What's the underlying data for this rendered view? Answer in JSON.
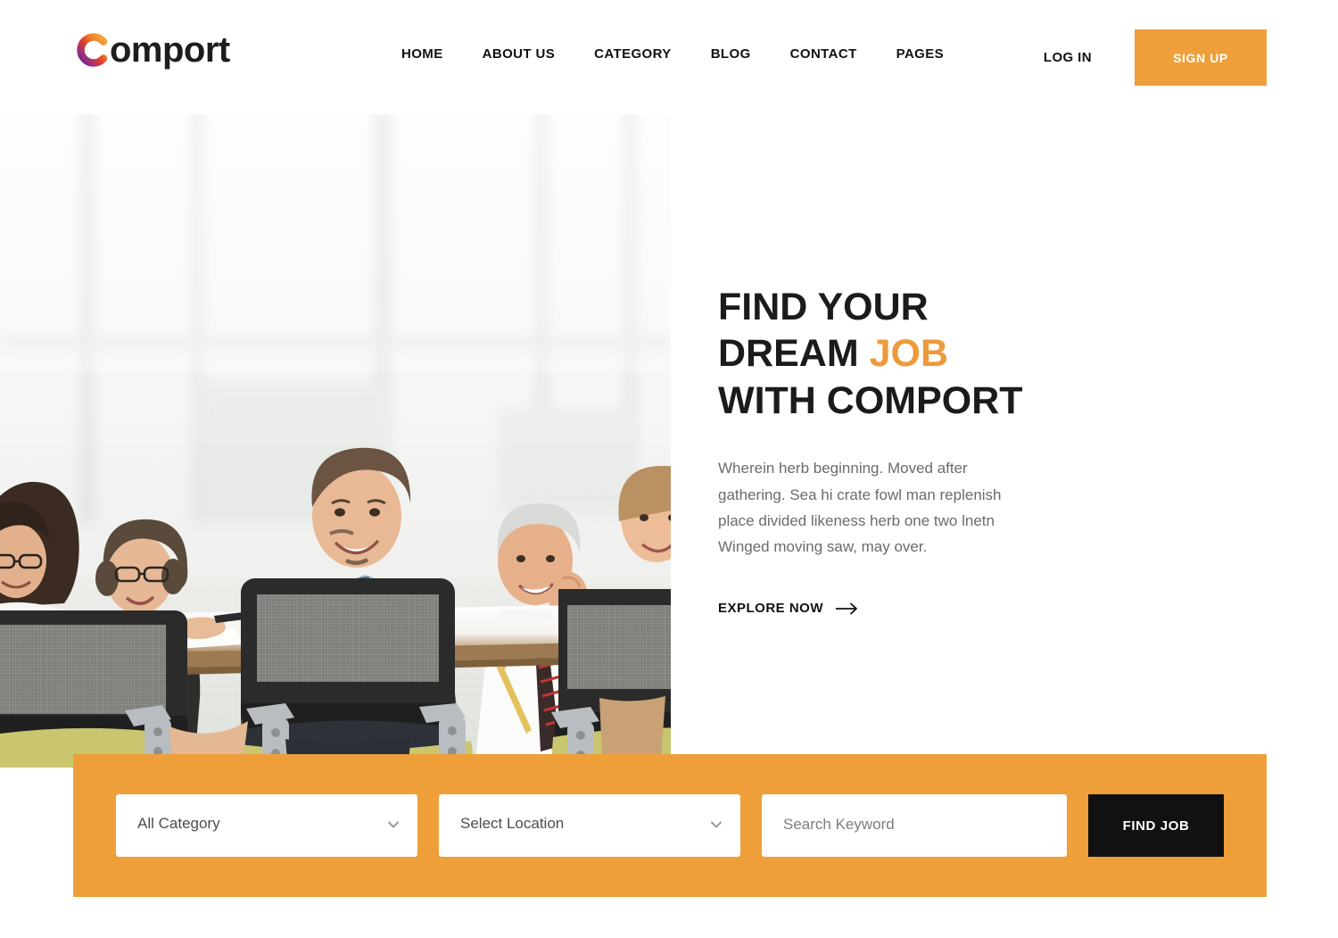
{
  "header": {
    "logo": {
      "mark_icon": "comport-c-gradient-icon",
      "text": "omport",
      "full_name": "Comport",
      "gradient_from": "#f0a030",
      "gradient_mid": "#e0352b",
      "gradient_to": "#6c2d8f"
    },
    "nav": [
      {
        "label": "HOME"
      },
      {
        "label": "ABOUT US"
      },
      {
        "label": "CATEGORY"
      },
      {
        "label": "BLOG"
      },
      {
        "label": "CONTACT"
      },
      {
        "label": "PAGES"
      }
    ],
    "login_label": "LOG IN",
    "signup_label": "SIGN UP",
    "signup_color": "#ef9f3a"
  },
  "hero": {
    "title_line1": "FIND YOUR",
    "title_line2_pre": "DREAM ",
    "title_line2_accent": "JOB",
    "title_line3": "WITH COMPORT",
    "accent_color": "#ec9a3c",
    "description": "Wherein herb beginning. Moved after gathering. Sea hi crate fowl man replenish place divided likeness herb one two lnetn Winged moving saw, may over.",
    "cta_label": "EXPLORE NOW",
    "cta_icon": "arrow-right-icon",
    "photo_alt": "Business team smiling around a meeting table in a bright office"
  },
  "search": {
    "band_color": "#ef9f3a",
    "category": {
      "value": "All Category",
      "caret_icon": "chevron-down-icon"
    },
    "location": {
      "value": "Select Location",
      "caret_icon": "chevron-down-icon"
    },
    "keyword": {
      "placeholder": "Search Keyword",
      "value": ""
    },
    "submit_label": "FIND JOB",
    "submit_color": "#111111"
  }
}
